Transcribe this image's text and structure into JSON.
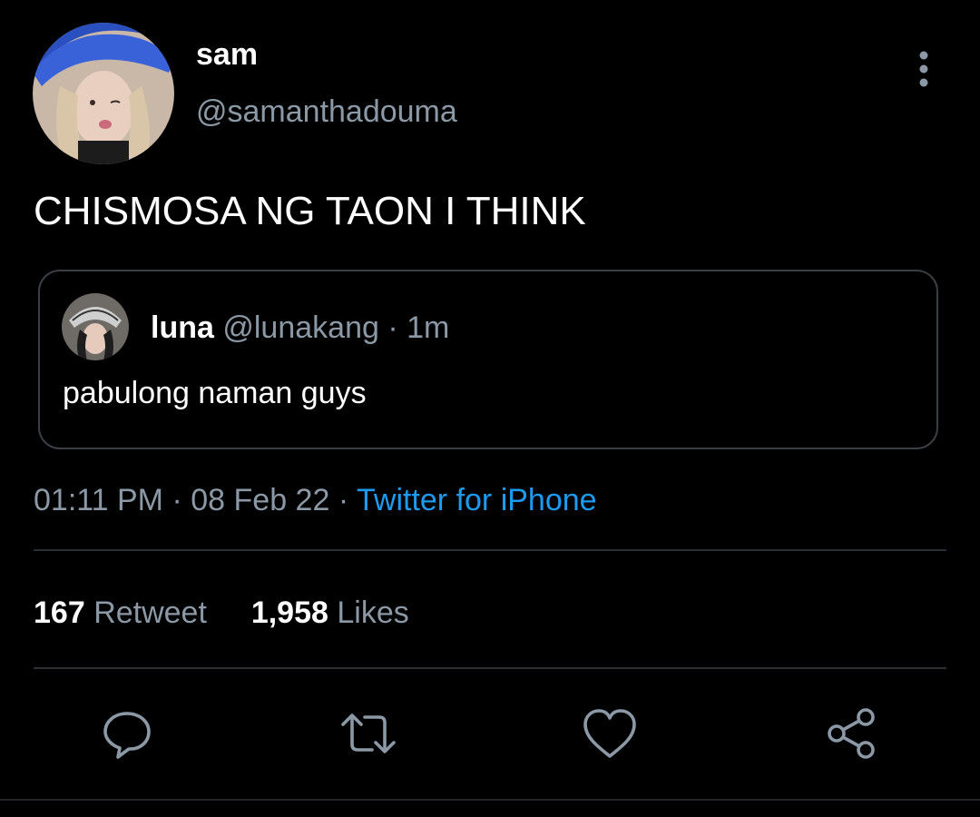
{
  "author": {
    "display_name": "sam",
    "handle": "@samanthadouma"
  },
  "tweet": {
    "text": "CHISMOSA NG TAON I THINK"
  },
  "quoted_tweet": {
    "display_name": "luna",
    "handle": "@lunakang",
    "separator": "·",
    "age": "1m",
    "text": "pabulong naman guys"
  },
  "meta": {
    "time": "01:11 PM",
    "separator": "·",
    "date": "08 Feb 22",
    "separator2": "·",
    "source": "Twitter for iPhone"
  },
  "stats": {
    "retweets_count": "167",
    "retweets_label": "Retweet",
    "likes_count": "1,958",
    "likes_label": "Likes"
  },
  "icons": {
    "more": "more-vertical-icon",
    "reply": "reply-icon",
    "retweet": "retweet-icon",
    "like": "heart-icon",
    "share": "share-icon"
  },
  "colors": {
    "background": "#000000",
    "text": "#ffffff",
    "muted": "#8b98a5",
    "accent": "#1d9bf0",
    "border": "#3a3f44"
  }
}
